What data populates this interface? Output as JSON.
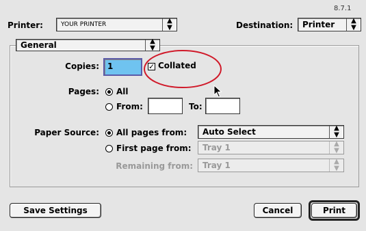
{
  "version": "8.7.1",
  "header": {
    "printer_label": "Printer:",
    "printer_value": "YOUR PRINTER",
    "destination_label": "Destination:",
    "destination_value": "Printer"
  },
  "panel": {
    "selected": "General"
  },
  "copies": {
    "label": "Copies:",
    "value": "1",
    "collated_label": "Collated",
    "collated_checked": true
  },
  "pages": {
    "label": "Pages:",
    "all_label": "All",
    "from_label": "From:",
    "to_label": "To:",
    "from_value": "",
    "to_value": ""
  },
  "paper_source": {
    "label": "Paper Source:",
    "all_pages_label": "All pages from:",
    "all_pages_value": "Auto Select",
    "first_page_label": "First page from:",
    "first_page_value": "Tray 1",
    "remaining_label": "Remaining from:",
    "remaining_value": "Tray 1"
  },
  "buttons": {
    "save_settings": "Save Settings",
    "cancel": "Cancel",
    "print": "Print"
  },
  "colors": {
    "annotation_circle": "#d01a2a",
    "copies_highlight": "#6fc3f0"
  },
  "icons": {
    "popup_arrows": "up-down-arrows-icon",
    "checkbox": "checkmark-icon",
    "cursor": "mouse-pointer-icon"
  }
}
